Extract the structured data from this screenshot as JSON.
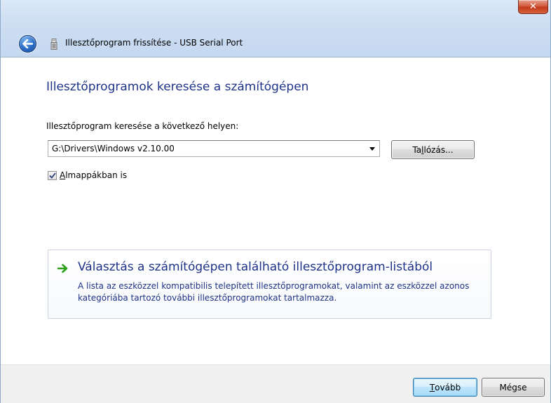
{
  "window": {
    "title": "Illesztőprogram frissítése - USB Serial Port",
    "close_label": "✕"
  },
  "main": {
    "heading": "Illesztőprogramok keresése a számítógépen",
    "path_label": "Illesztőprogram keresése a következő helyen:",
    "path_value": "G:\\Drivers\\Windows v2.10.00",
    "browse_pre": "Ta",
    "browse_key": "l",
    "browse_post": "lózás...",
    "subfolders_checked": true,
    "subfolders_key": "A",
    "subfolders_rest": "lmappákban is"
  },
  "pick_list": {
    "title": "Választás a számítógépen található illesztőprogram-listából",
    "description": "A lista az eszközzel kompatibilis telepített illesztőprogramokat, valamint az eszközzel azonos kategóriába tartozó további illesztőprogramokat tartalmazza."
  },
  "footer": {
    "next_key": "T",
    "next_rest": "ovább",
    "cancel_label": "Mégse"
  },
  "colors": {
    "heading_blue": "#1e3287",
    "green_arrow": "#2ea31a",
    "close_red": "#c23a1b"
  },
  "icons": {
    "back": "back-arrow-icon",
    "device": "usb-device-icon",
    "close": "close-icon",
    "dropdown": "chevron-down-icon",
    "command_link": "green-arrow-icon",
    "check": "checkmark-icon"
  }
}
